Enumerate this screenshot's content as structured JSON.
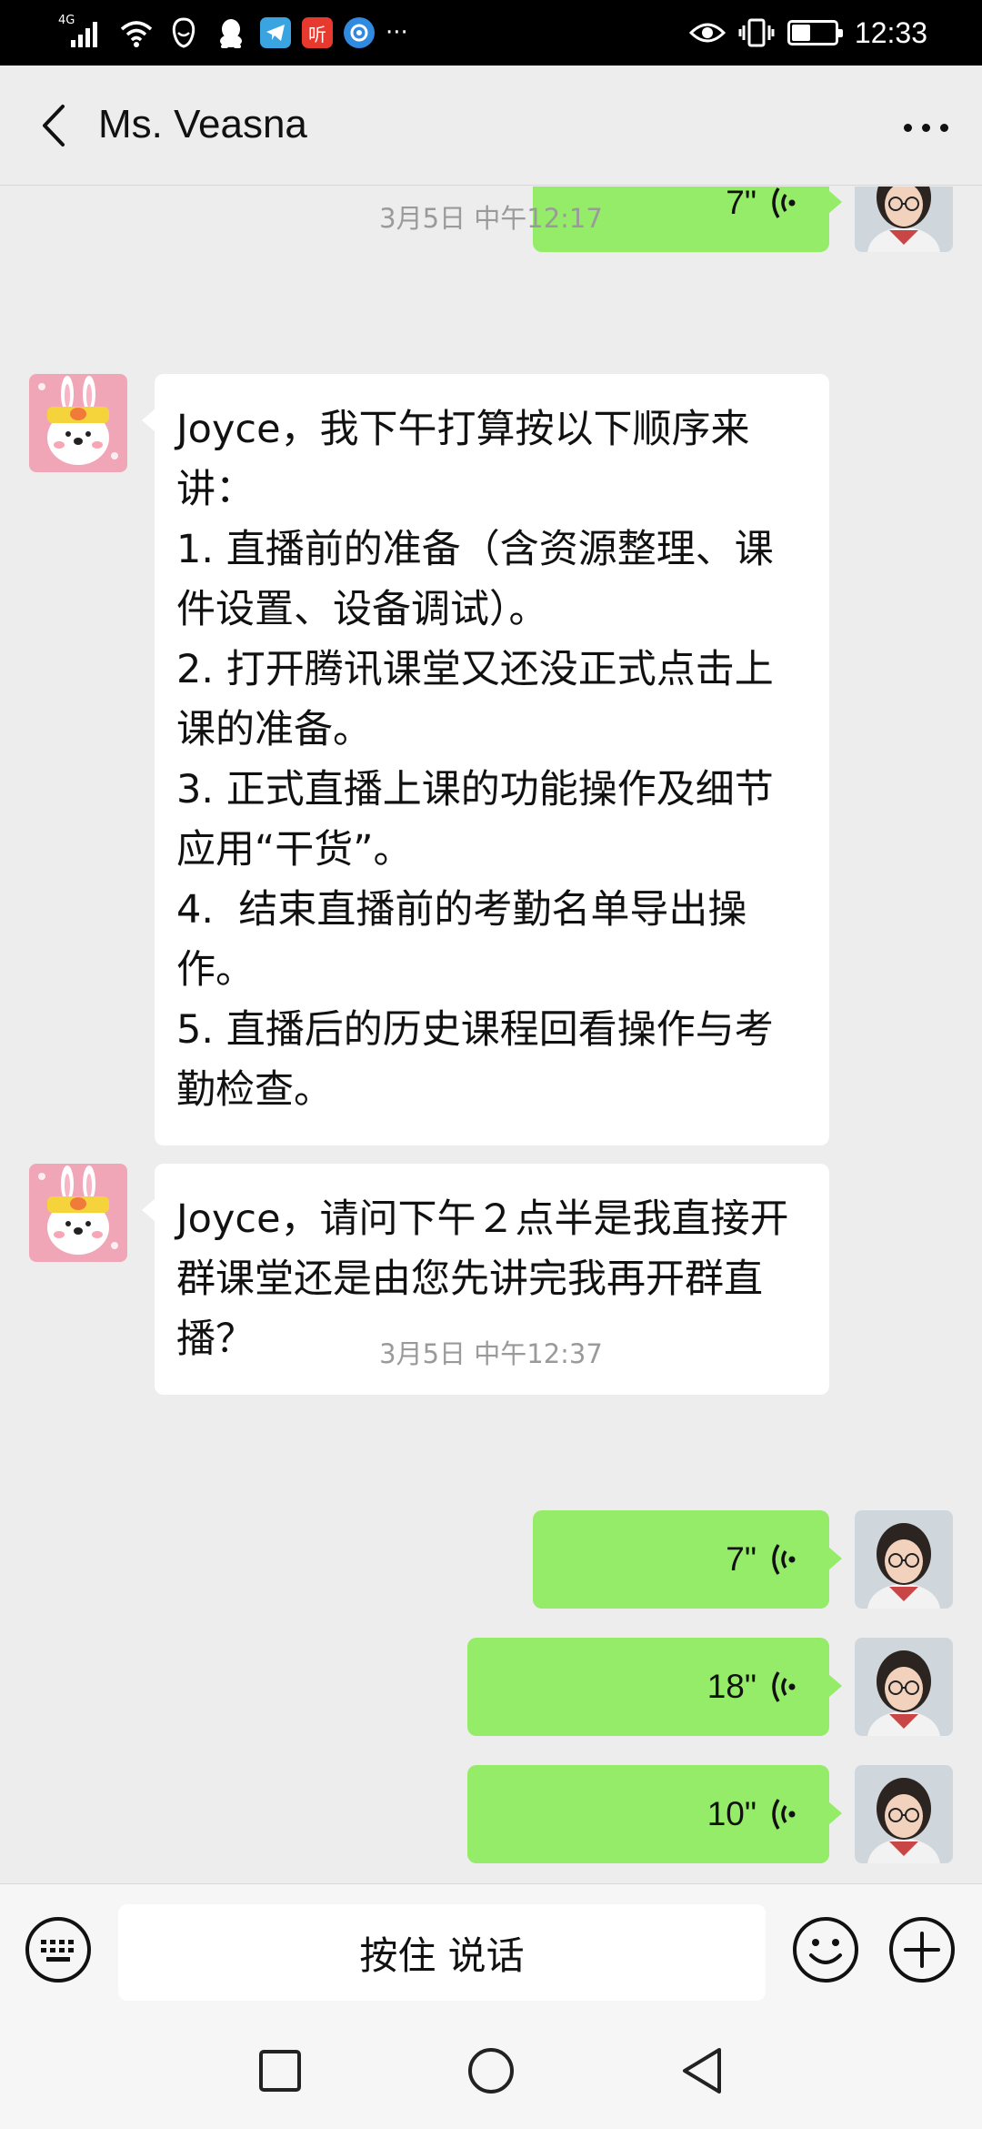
{
  "status_bar": {
    "network": "4G",
    "time": "12:33",
    "battery_percent": 40,
    "icons": [
      "signal-icon",
      "wifi-icon",
      "app-notification-icon",
      "qq-icon",
      "telegram-icon",
      "ting-app-icon",
      "browser-app-icon",
      "more-notifications-icon",
      "eye-comfort-icon",
      "vibrate-icon",
      "battery-icon"
    ],
    "ting_label": "听",
    "more_label": "···"
  },
  "header": {
    "title": "Ms. Veasna"
  },
  "messages": {
    "top_partial": {
      "duration": "7\""
    },
    "timestamp_1": "3月5日 中午12:17",
    "text_1": "Joyce，我下午打算按以下顺序来讲：\n1. 直播前的准备（含资源整理、课件设置、设备调试）。\n2. 打开腾讯课堂又还没正式点击上课的准备。\n3. 正式直播上课的功能操作及细节应用“干货”。\n4.  结束直播前的考勤名单导出操作。\n5. 直播后的历史课程回看操作与考勤检查。",
    "text_2": "Joyce，请问下午２点半是我直接开群课堂还是由您先讲完我再开群直播？",
    "timestamp_2": "3月5日 中午12:37",
    "voice_1": {
      "duration": "7\""
    },
    "voice_2": {
      "duration": "18\""
    },
    "voice_3": {
      "duration": "10\""
    }
  },
  "input_bar": {
    "hold_to_talk_label": "按住 说话",
    "keyboard_icon": "keyboard-icon",
    "emoji_icon": "emoji-icon",
    "add_icon": "plus-icon"
  },
  "nav_bar": {
    "icons": [
      "recent-apps-icon",
      "home-icon",
      "back-icon"
    ]
  },
  "colors": {
    "outgoing_bubble": "#95ec69",
    "incoming_bubble": "#ffffff",
    "chat_background": "#ededed",
    "timestamp_text": "#9a9a9a"
  }
}
